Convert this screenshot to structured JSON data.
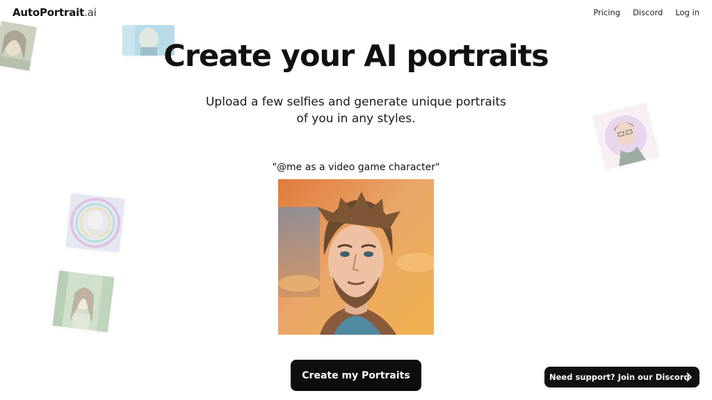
{
  "brand": {
    "name": "AutoPortrait",
    "suffix": ".ai"
  },
  "nav": {
    "items": [
      "Pricing",
      "Discord",
      "Log in"
    ]
  },
  "hero": {
    "title": "Create your AI portraits",
    "subtitle_line1": "Upload a few selfies and generate unique portraits",
    "subtitle_line2": "of you in any styles."
  },
  "example": {
    "prompt": "\"@me as a video game character\""
  },
  "cta": {
    "label": "Create my Portraits"
  },
  "support": {
    "label": "Need support? Join our Discord"
  },
  "colors": {
    "text": "#111111",
    "button_bg": "#0d0d0d",
    "button_text": "#ffffff",
    "background": "#ffffff"
  },
  "icons": {
    "support_arrow": "chevron-right-icon"
  }
}
